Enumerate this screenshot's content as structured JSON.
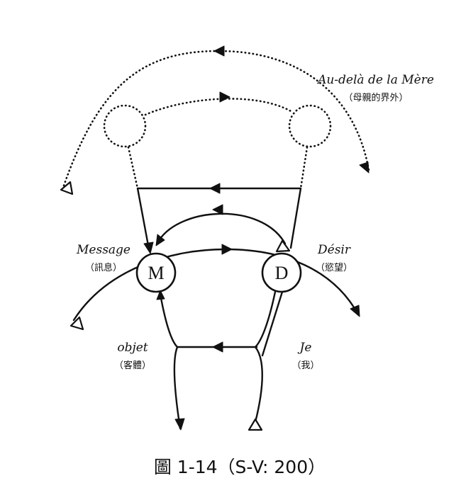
{
  "diagram": {
    "beyond_mother": {
      "label": "Au-delà de la Mère",
      "label_zh": "（母親的界外）"
    },
    "message": {
      "label": "Message",
      "label_zh": "（訊息）"
    },
    "desire": {
      "label": "Désir",
      "label_zh": "（慾望）"
    },
    "object": {
      "label": "objet",
      "label_zh": "（客體）"
    },
    "ego": {
      "label": "Je",
      "label_zh": "（我）"
    },
    "node_m": {
      "letter": "M"
    },
    "node_d": {
      "letter": "D"
    }
  },
  "caption": "圖 1-14（S-V: 200）"
}
